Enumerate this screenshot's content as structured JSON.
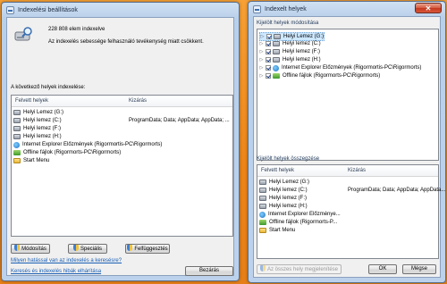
{
  "left_window": {
    "title": "Indexelési beállítások",
    "close": "✕",
    "status_count": "228 808 elem indexelve",
    "status_message": "Az indexelés sebessége felhasználó tevékenység miatt csökkent.",
    "section_label": "A következő helyek indexelése:",
    "columns": [
      "Felvett helyek",
      "Kizárás"
    ],
    "rows": [
      {
        "icon": "drive-icon",
        "name": "Helyi Lemez (G:)",
        "exclude": ""
      },
      {
        "icon": "drive-icon",
        "name": "Helyi lemez (C:)",
        "exclude": "ProgramData; Data; AppData; AppData; ..."
      },
      {
        "icon": "drive-icon",
        "name": "Helyi lemez (F:)",
        "exclude": ""
      },
      {
        "icon": "drive-icon",
        "name": "Helyi lemez (H:)",
        "exclude": ""
      },
      {
        "icon": "ie-icon",
        "name": "Internet Explorer Előzmények (Rigormortis-PC\\Rigormorts)",
        "exclude": ""
      },
      {
        "icon": "offline-icon",
        "name": "Offline fájlok (Rigormorts-PC\\Rigormorts)",
        "exclude": ""
      },
      {
        "icon": "folder-icon",
        "name": "Start Menu",
        "exclude": ""
      }
    ],
    "buttons": {
      "modify": "Módosítás",
      "advanced": "Speciális",
      "pause": "Felfüggesztés",
      "close": "Bezárás"
    },
    "links": {
      "effect": "Milyen hatással van az indexelés a keresésre?",
      "troubleshoot": "Keresés és indexelés hibák elhárítása"
    }
  },
  "right_window": {
    "title": "Indexelt helyek",
    "close": "✕",
    "change_group_label": "Kijelölt helyek módosítása",
    "tree": [
      {
        "checked": true,
        "icon": "drive-icon",
        "name": "Helyi Lemez  (G:)",
        "selected": true
      },
      {
        "checked": true,
        "icon": "drive-icon",
        "name": "Helyi lemez (C:)",
        "selected": false
      },
      {
        "checked": true,
        "icon": "drive-icon",
        "name": "Helyi lemez (F:)",
        "selected": false
      },
      {
        "checked": true,
        "icon": "drive-icon",
        "name": "Helyi lemez (H:)",
        "selected": false
      },
      {
        "checked": true,
        "icon": "ie-icon",
        "name": "Internet Explorer Előzmények (Rigormortis-PC\\Rigormorts)",
        "selected": false
      },
      {
        "checked": true,
        "icon": "offline-icon",
        "name": "Offline fájlok (Rigormorts-PC\\Rigormorts)",
        "selected": false
      }
    ],
    "summary_group_label": "Kijelölt helyek összegzése",
    "summary_columns": [
      "Felvett helyek",
      "Kizárás"
    ],
    "summary_rows": [
      {
        "icon": "drive-icon",
        "name": "Helyi Lemez (G:)",
        "exclude": ""
      },
      {
        "icon": "drive-icon",
        "name": "Helyi lemez (C:)",
        "exclude": "ProgramData; Data; AppData; AppData..."
      },
      {
        "icon": "drive-icon",
        "name": "Helyi lemez (F:)",
        "exclude": ""
      },
      {
        "icon": "drive-icon",
        "name": "Helyi lemez (H:)",
        "exclude": ""
      },
      {
        "icon": "ie-icon",
        "name": "Internet Explorer Előzménye...",
        "exclude": ""
      },
      {
        "icon": "offline-icon",
        "name": "Offline fájlok (Rigormorts-P...",
        "exclude": ""
      },
      {
        "icon": "folder-icon",
        "name": "Start Menu",
        "exclude": ""
      }
    ],
    "buttons": {
      "show_all": "Az összes hely megjelenítése",
      "ok": "OK",
      "cancel": "Mégse"
    }
  }
}
